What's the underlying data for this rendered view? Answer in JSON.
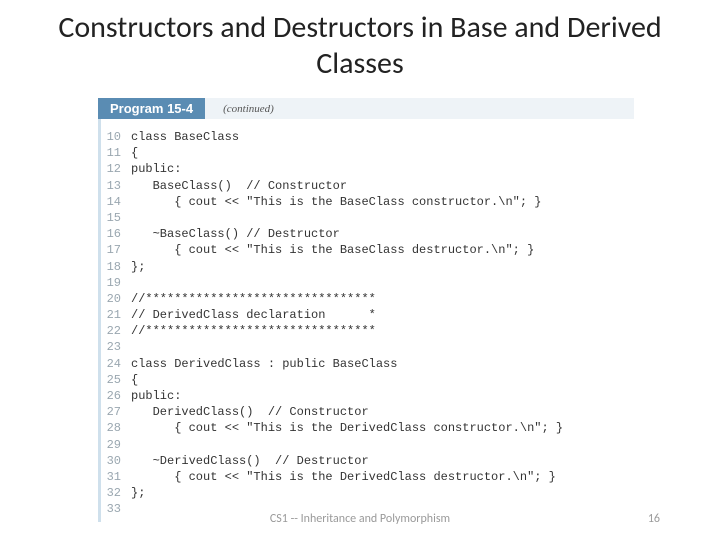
{
  "title": "Constructors and Destructors in Base and Derived Classes",
  "header": {
    "program_label": "Program 15-4",
    "continued": "(continued)"
  },
  "code": [
    {
      "n": "10",
      "t": "class BaseClass"
    },
    {
      "n": "11",
      "t": "{"
    },
    {
      "n": "12",
      "t": "public:"
    },
    {
      "n": "13",
      "t": "   BaseClass()  // Constructor"
    },
    {
      "n": "14",
      "t": "      { cout << \"This is the BaseClass constructor.\\n\"; }"
    },
    {
      "n": "15",
      "t": ""
    },
    {
      "n": "16",
      "t": "   ~BaseClass() // Destructor"
    },
    {
      "n": "17",
      "t": "      { cout << \"This is the BaseClass destructor.\\n\"; }"
    },
    {
      "n": "18",
      "t": "};"
    },
    {
      "n": "19",
      "t": ""
    },
    {
      "n": "20",
      "t": "//********************************"
    },
    {
      "n": "21",
      "t": "// DerivedClass declaration      *"
    },
    {
      "n": "22",
      "t": "//********************************"
    },
    {
      "n": "23",
      "t": ""
    },
    {
      "n": "24",
      "t": "class DerivedClass : public BaseClass"
    },
    {
      "n": "25",
      "t": "{"
    },
    {
      "n": "26",
      "t": "public:"
    },
    {
      "n": "27",
      "t": "   DerivedClass()  // Constructor"
    },
    {
      "n": "28",
      "t": "      { cout << \"This is the DerivedClass constructor.\\n\"; }"
    },
    {
      "n": "29",
      "t": ""
    },
    {
      "n": "30",
      "t": "   ~DerivedClass()  // Destructor"
    },
    {
      "n": "31",
      "t": "      { cout << \"This is the DerivedClass destructor.\\n\"; }"
    },
    {
      "n": "32",
      "t": "};"
    },
    {
      "n": "33",
      "t": ""
    }
  ],
  "footer": "CS1 -- Inheritance and Polymorphism",
  "page": "16"
}
